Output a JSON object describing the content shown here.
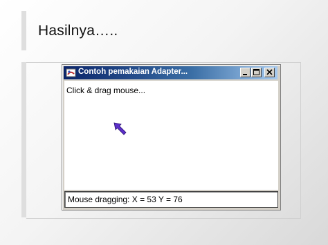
{
  "slide": {
    "title": "Hasilnya….."
  },
  "window": {
    "title": "Contoh pemakaian Adapter...",
    "icons": {
      "app": "java-app-icon",
      "minimize": "minimize-icon",
      "maximize": "maximize-icon",
      "close": "close-icon"
    },
    "instruction": "Click & drag mouse...",
    "cursor_icon": "arrow-cursor-icon",
    "status": "Mouse dragging: X = 53 Y = 76"
  },
  "colors": {
    "titlebar_start": "#0a246a",
    "titlebar_end": "#a6caf0",
    "window_face": "#d4d0c8",
    "cursor": "#5b2fc9"
  }
}
